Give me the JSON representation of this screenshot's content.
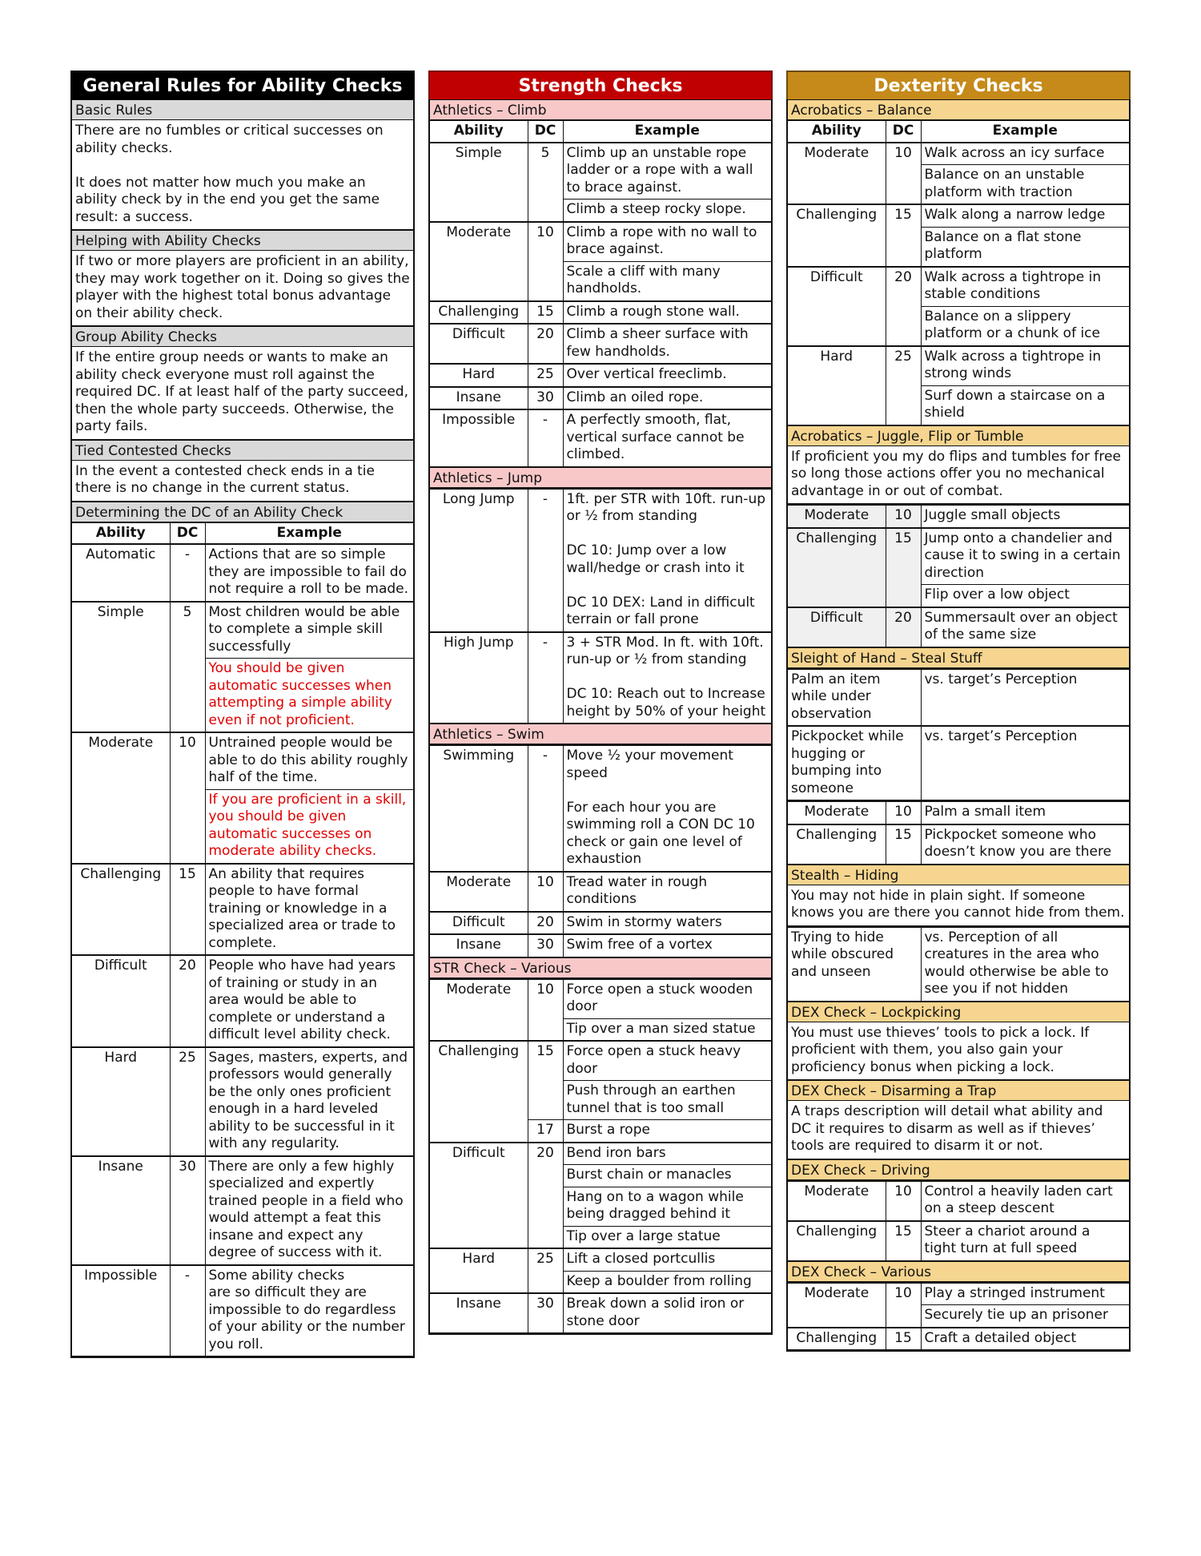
{
  "general": {
    "title": "General Rules for Ability Checks",
    "basic_rules": {
      "heading": "Basic Rules",
      "text": "There are no fumbles or critical successes on ability checks.\n\nIt does not matter how much you make an ability check by in the end you get the same result: a success."
    },
    "helping": {
      "heading": "Helping with Ability Checks",
      "text": "If two or more players are proficient in an ability, they may work together on it.  Doing so gives the player with the highest total bonus advantage on their ability check."
    },
    "group": {
      "heading": "Group Ability Checks",
      "text": "If the entire group needs or wants to make an ability check everyone must roll against the required DC.  If at least half of the party succeed, then the whole party succeeds. Otherwise, the party fails."
    },
    "tied": {
      "heading": "Tied Contested Checks",
      "text": "In the event a contested check ends in a tie there is no change in the current status."
    },
    "dc_table": {
      "heading": "Determining the DC of an Ability Check",
      "columns": [
        "Ability",
        "DC",
        "Example"
      ],
      "rows": [
        {
          "ability": "Automatic",
          "dc": "-",
          "examples": [
            {
              "text": "Actions that are so simple they are impossible to fail do not require a roll to be made."
            }
          ]
        },
        {
          "ability": "Simple",
          "dc": "5",
          "examples": [
            {
              "text": "Most children would be able to complete a simple skill successfully"
            },
            {
              "text": "You should be given automatic successes when attempting a simple ability even if not proficient.",
              "highlight": true
            }
          ]
        },
        {
          "ability": "Moderate",
          "dc": "10",
          "examples": [
            {
              "text": "Untrained people would be able to do this ability roughly half of the time."
            },
            {
              "text": "If you are proficient in a skill, you should be given automatic successes on moderate ability checks.",
              "highlight": true
            }
          ]
        },
        {
          "ability": "Challenging",
          "dc": "15",
          "examples": [
            {
              "text": "An ability that requires people to have formal training or knowledge in a specialized area or trade to complete."
            }
          ]
        },
        {
          "ability": "Difficult",
          "dc": "20",
          "examples": [
            {
              "text": "People who have had years of training or study in an area would be able to complete or understand a difficult level ability check."
            }
          ]
        },
        {
          "ability": "Hard",
          "dc": "25",
          "examples": [
            {
              "text": "Sages, masters, experts, and professors would generally be the only ones proficient enough in a hard leveled ability to be successful in it with any regularity."
            }
          ]
        },
        {
          "ability": "Insane",
          "dc": "30",
          "examples": [
            {
              "text": "There are only a few highly specialized and expertly trained people in a field who would attempt a feat this insane and expect any degree of success with it."
            }
          ]
        },
        {
          "ability": "Impossible",
          "dc": "-",
          "examples": [
            {
              "text": "Some ability checks\nare so difficult they are impossible to do regardless of your ability or the number you roll."
            }
          ]
        }
      ]
    }
  },
  "strength": {
    "title": "Strength Checks",
    "columns": [
      "Ability",
      "DC",
      "Example"
    ],
    "sections": [
      {
        "heading": "Athletics – Climb",
        "show_header": true,
        "rows": [
          {
            "ability": "Simple",
            "dc": "5",
            "examples": [
              "Climb up an unstable rope ladder or a rope with a wall to brace against.",
              "Climb a steep rocky slope."
            ]
          },
          {
            "ability": "Moderate",
            "dc": "10",
            "examples": [
              "Climb a rope with no wall to brace against.",
              "Scale a cliff with many handholds."
            ]
          },
          {
            "ability": "Challenging",
            "dc": "15",
            "examples": [
              "Climb a rough stone wall."
            ]
          },
          {
            "ability": "Difficult",
            "dc": "20",
            "examples": [
              "Climb a sheer surface with few handholds."
            ]
          },
          {
            "ability": "Hard",
            "dc": "25",
            "examples": [
              "Over vertical freeclimb."
            ]
          },
          {
            "ability": "Insane",
            "dc": "30",
            "examples": [
              "Climb an oiled rope."
            ]
          },
          {
            "ability": "Impossible",
            "dc": "-",
            "examples": [
              "A perfectly smooth, flat, vertical surface cannot be climbed."
            ]
          }
        ]
      },
      {
        "heading": "Athletics – Jump",
        "rows": [
          {
            "ability": "Long Jump",
            "dc": "-",
            "examples": [
              "1ft. per STR with 10ft. run-up or ½ from standing\n\nDC 10: Jump over a low wall/hedge or crash into it\n\nDC 10 DEX: Land in difficult terrain or fall prone"
            ]
          },
          {
            "ability": "High Jump",
            "dc": "-",
            "examples": [
              "3 + STR Mod. In ft. with 10ft. run-up or ½ from standing\n\nDC 10: Reach out to Increase height by 50% of your height"
            ]
          }
        ]
      },
      {
        "heading": "Athletics – Swim",
        "rows": [
          {
            "ability": "Swimming",
            "dc": "-",
            "examples": [
              "Move ½ your movement speed\n\nFor each hour you are swimming roll a CON DC 10 check or gain one level of exhaustion"
            ]
          },
          {
            "ability": "Moderate",
            "dc": "10",
            "examples": [
              "Tread water in rough conditions"
            ]
          },
          {
            "ability": "Difficult",
            "dc": "20",
            "examples": [
              "Swim in stormy waters"
            ]
          },
          {
            "ability": "Insane",
            "dc": "30",
            "examples": [
              "Swim free of a vortex"
            ]
          }
        ]
      },
      {
        "heading": "STR Check – Various",
        "rows": [
          {
            "ability": "Moderate",
            "dc": "10",
            "examples": [
              "Force open a stuck wooden door",
              "Tip over a man sized statue"
            ]
          },
          {
            "ability": "Challenging",
            "dc": "15",
            "examples": [
              "Force open a stuck heavy door",
              "Push through an earthen tunnel that is too small"
            ],
            "extra": {
              "dc": "17",
              "example": "Burst a rope"
            }
          },
          {
            "ability": "Difficult",
            "dc": "20",
            "examples": [
              "Bend iron bars",
              "Burst chain or manacles",
              "Hang on to a wagon while being dragged behind it",
              "Tip over a large statue"
            ]
          },
          {
            "ability": "Hard",
            "dc": "25",
            "examples": [
              "Lift a closed portcullis",
              "Keep a boulder from rolling"
            ]
          },
          {
            "ability": "Insane",
            "dc": "30",
            "examples": [
              "Break down a solid iron or stone door"
            ]
          }
        ]
      }
    ]
  },
  "dexterity": {
    "title": "Dexterity Checks",
    "columns": [
      "Ability",
      "DC",
      "Example"
    ],
    "balance": {
      "heading": "Acrobatics – Balance",
      "rows": [
        {
          "ability": "Moderate",
          "dc": "10",
          "examples": [
            "Walk across an icy surface",
            "Balance on an unstable platform with traction"
          ]
        },
        {
          "ability": "Challenging",
          "dc": "15",
          "examples": [
            "Walk along a narrow ledge",
            "Balance on a flat stone platform"
          ]
        },
        {
          "ability": "Difficult",
          "dc": "20",
          "examples": [
            "Walk across a tightrope in stable conditions",
            "Balance on a slippery platform or a chunk of ice"
          ]
        },
        {
          "ability": "Hard",
          "dc": "25",
          "examples": [
            "Walk across a tightrope in strong winds",
            "Surf down a staircase on a shield"
          ]
        }
      ]
    },
    "juggle": {
      "heading": "Acrobatics – Juggle, Flip or Tumble",
      "text": "If proficient you my do flips and tumbles for free so long those actions offer you no mechanical advantage in or out of combat.",
      "rows": [
        {
          "ability": "Moderate",
          "dc": "10",
          "examples": [
            "Juggle small objects"
          ]
        },
        {
          "ability": "Challenging",
          "dc": "15",
          "examples": [
            "Jump onto a chandelier and cause it to swing in a certain direction",
            "Flip over a low object"
          ]
        },
        {
          "ability": "Difficult",
          "dc": "20",
          "examples": [
            "Summersault over an object of the same size"
          ]
        }
      ]
    },
    "sleight": {
      "heading": "Sleight of Hand – Steal Stuff",
      "contested": [
        {
          "action": "Palm an item while under observation",
          "vs": "vs. target’s Perception"
        },
        {
          "action": "Pickpocket while hugging or bumping into someone",
          "vs": "vs. target’s Perception"
        }
      ],
      "rows": [
        {
          "ability": "Moderate",
          "dc": "10",
          "examples": [
            "Palm a small item"
          ]
        },
        {
          "ability": "Challenging",
          "dc": "15",
          "examples": [
            "Pickpocket someone who doesn’t know you are there"
          ]
        }
      ]
    },
    "stealth": {
      "heading": "Stealth – Hiding",
      "text": "You may not hide in plain sight.  If someone knows you are there you cannot hide from them.",
      "contested": [
        {
          "action": "Trying to hide while obscured and unseen",
          "vs": "vs. Perception of all creatures in the area who would otherwise be able to see you if not hidden"
        }
      ]
    },
    "lockpicking": {
      "heading": "DEX Check – Lockpicking",
      "text": "You must use thieves’ tools to pick a lock. If proficient with them, you also gain your proficiency bonus when picking a lock."
    },
    "trap": {
      "heading": "DEX Check – Disarming a Trap",
      "text": "A traps description will detail what ability and DC it requires to disarm as well as if thieves’ tools are required to disarm it or not."
    },
    "driving": {
      "heading": "DEX Check – Driving",
      "rows": [
        {
          "ability": "Moderate",
          "dc": "10",
          "examples": [
            "Control a heavily laden cart on a steep descent"
          ]
        },
        {
          "ability": "Challenging",
          "dc": "15",
          "examples": [
            "Steer a chariot around a tight turn at full speed"
          ]
        }
      ]
    },
    "various": {
      "heading": "DEX Check – Various",
      "rows": [
        {
          "ability": "Moderate",
          "dc": "10",
          "examples": [
            "Play a stringed instrument",
            "Securely tie up an prisoner"
          ]
        },
        {
          "ability": "Challenging",
          "dc": "15",
          "examples": [
            "Craft a detailed object"
          ]
        }
      ]
    }
  },
  "colors": {
    "general_header": "#000000",
    "general_sub": "#d9d9d9",
    "strength_header": "#c00000",
    "strength_sub": "#f8c8c8",
    "dexterity_header": "#c58a1a",
    "dexterity_sub": "#f5d58f",
    "highlight_text": "#e00000"
  }
}
